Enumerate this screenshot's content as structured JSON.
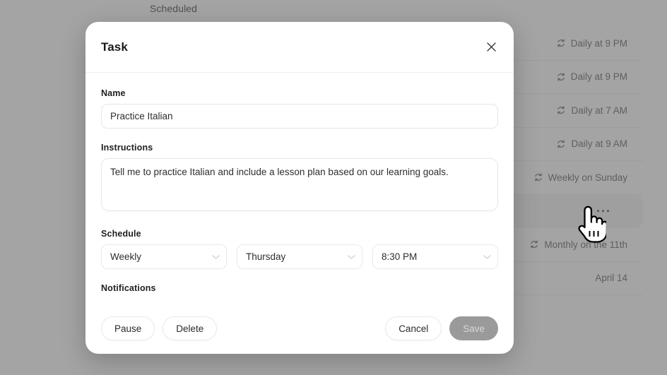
{
  "background": {
    "header_title": "Scheduled",
    "rows": [
      {
        "icon": "repeat-icon",
        "meta": "Daily at 9 PM",
        "type": "schedule",
        "highlighted": false
      },
      {
        "icon": "repeat-icon",
        "meta": "Daily at 9 PM",
        "type": "schedule",
        "highlighted": false
      },
      {
        "icon": "repeat-icon",
        "meta": "Daily at 7 AM",
        "type": "schedule",
        "highlighted": false
      },
      {
        "icon": "repeat-icon",
        "meta": "Daily at 9 AM",
        "type": "schedule",
        "highlighted": false
      },
      {
        "icon": "repeat-icon",
        "meta": "Weekly on Sunday",
        "type": "schedule",
        "highlighted": false
      },
      {
        "icon": "more-horizontal-icon",
        "meta": "",
        "type": "menu",
        "highlighted": true
      },
      {
        "icon": "repeat-icon",
        "meta": "Monthly on the 11th",
        "type": "schedule",
        "highlighted": false
      },
      {
        "icon": "",
        "meta": "April 14",
        "type": "date",
        "highlighted": false
      }
    ]
  },
  "modal": {
    "title": "Task",
    "close_icon": "close-icon",
    "fields": {
      "name": {
        "label": "Name",
        "value": "Practice Italian",
        "placeholder": "Name"
      },
      "instructions": {
        "label": "Instructions",
        "value": "Tell me to practice Italian and include a lesson plan based on our learning goals.",
        "placeholder": "Instructions"
      },
      "schedule": {
        "label": "Schedule",
        "frequency": "Weekly",
        "day": "Thursday",
        "time": "8:30 PM",
        "chevron_icon": "chevron-down-icon"
      },
      "notifications": {
        "label": "Notifications"
      }
    },
    "footer": {
      "pause_label": "Pause",
      "delete_label": "Delete",
      "cancel_label": "Cancel",
      "save_label": "Save"
    }
  },
  "colors": {
    "scrim": "#6c6c6c",
    "modal_bg": "#ffffff",
    "save_disabled_bg": "#9a9a9a",
    "save_disabled_text": "#d8d8d8",
    "border": "#e6e6e6",
    "text_primary": "#1f1f1f",
    "text_secondary": "#4a4a4a"
  },
  "cursor": {
    "icon": "pointing-hand-cursor"
  }
}
